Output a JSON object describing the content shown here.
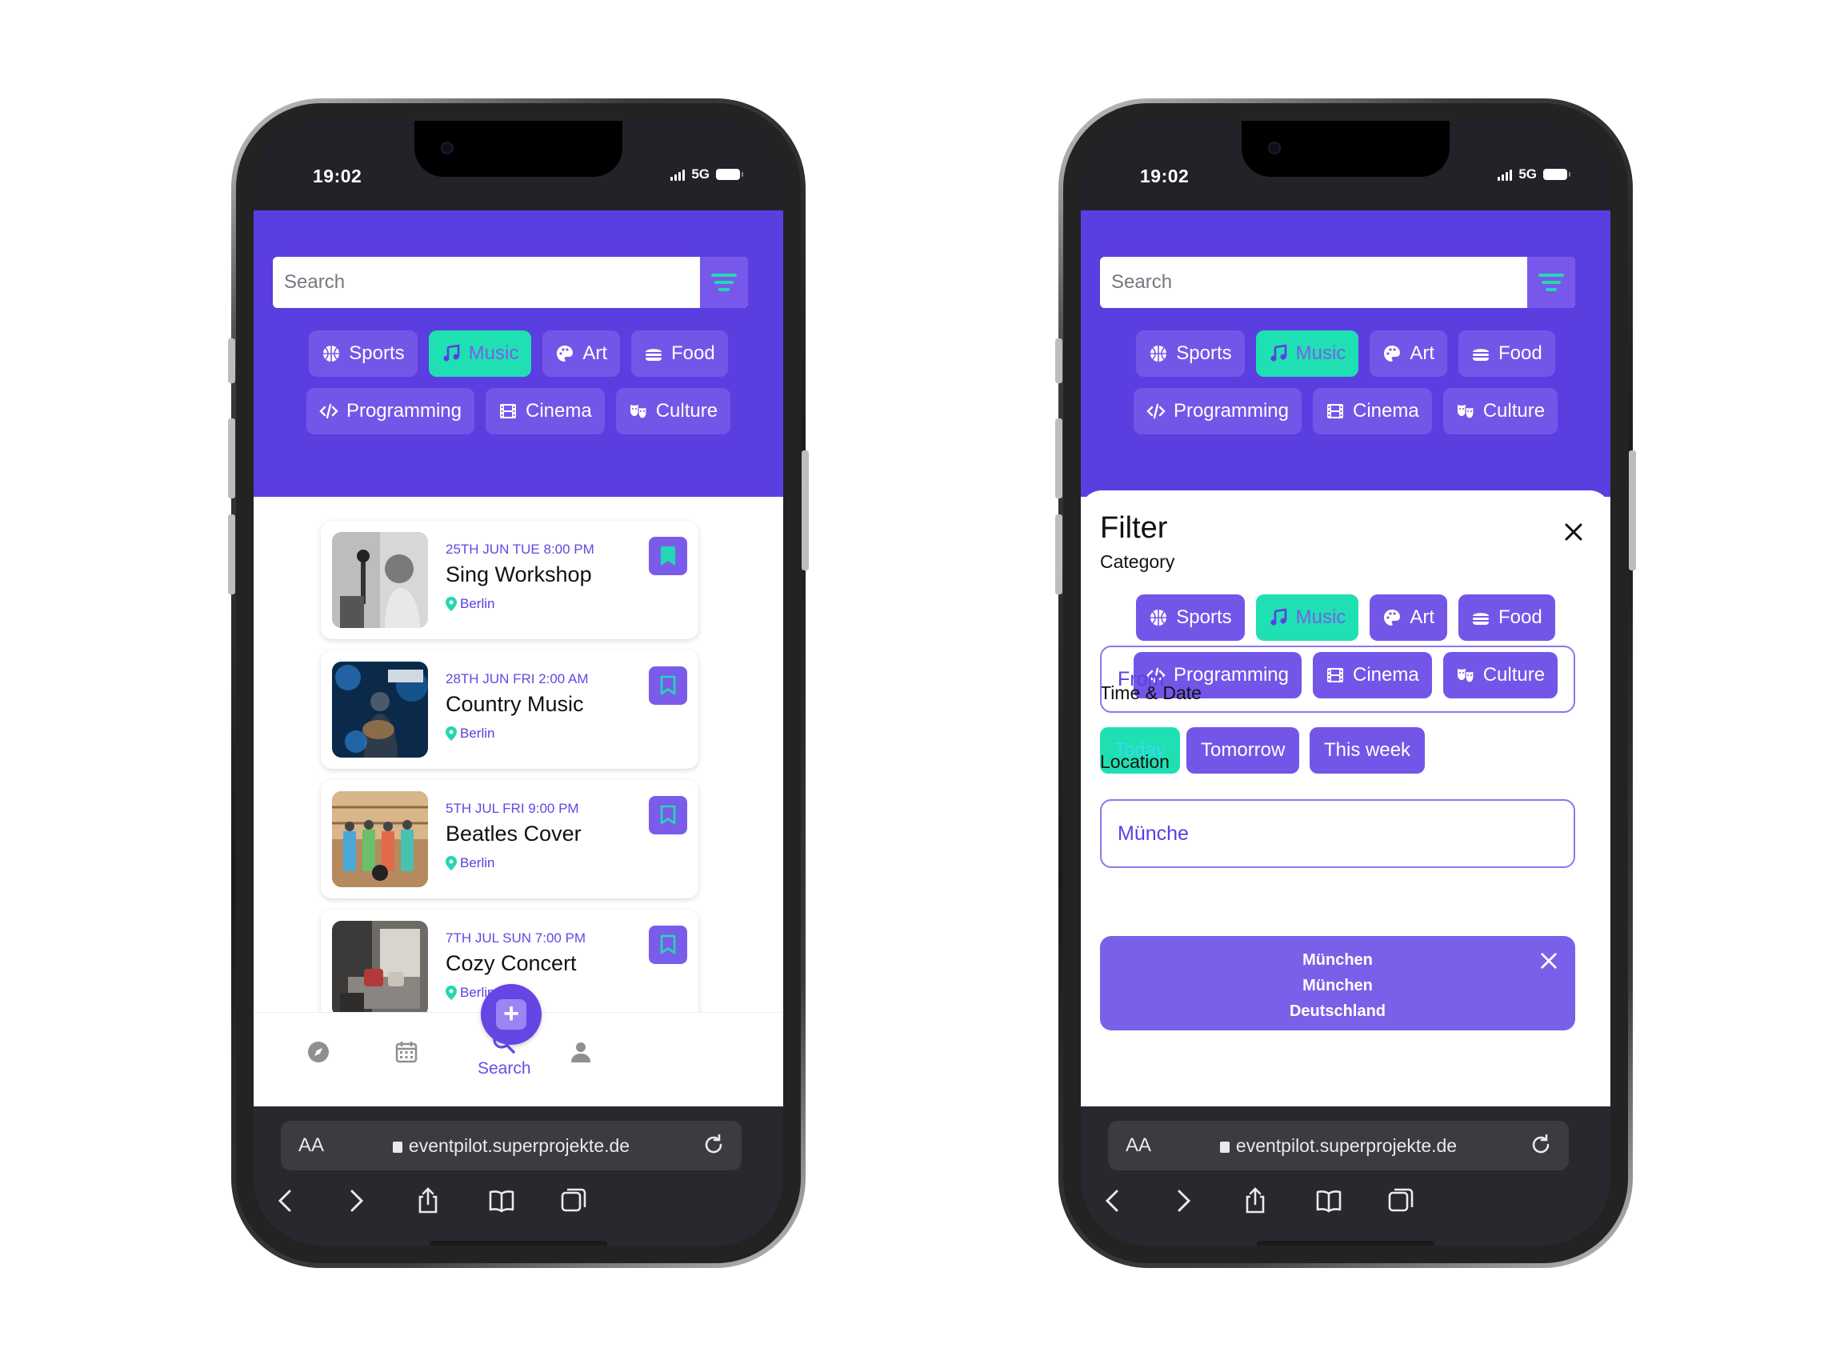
{
  "status": {
    "time": "19:02",
    "network": "5G"
  },
  "search": {
    "placeholder": "Search"
  },
  "categories": [
    {
      "label": "Sports",
      "icon": "basketball-icon",
      "selected": false
    },
    {
      "label": "Music",
      "icon": "music-note-icon",
      "selected": true
    },
    {
      "label": "Art",
      "icon": "palette-icon",
      "selected": false
    },
    {
      "label": "Food",
      "icon": "burger-icon",
      "selected": false
    },
    {
      "label": "Programming",
      "icon": "code-icon",
      "selected": false
    },
    {
      "label": "Cinema",
      "icon": "film-icon",
      "selected": false
    },
    {
      "label": "Culture",
      "icon": "theater-masks-icon",
      "selected": false
    }
  ],
  "events": [
    {
      "date": "25TH JUN TUE 8:00 PM",
      "title": "Sing Workshop",
      "location": "Berlin",
      "bookmarked": true
    },
    {
      "date": "28TH JUN FRI 2:00 AM",
      "title": "Country Music",
      "location": "Berlin",
      "bookmarked": false
    },
    {
      "date": "5TH JUL FRI 9:00 PM",
      "title": "Beatles Cover",
      "location": "Berlin",
      "bookmarked": false
    },
    {
      "date": "7TH JUL SUN 7:00 PM",
      "title": "Cozy Concert",
      "location": "Berlin",
      "bookmarked": false
    }
  ],
  "bottom_nav": {
    "items": [
      {
        "icon": "compass-icon"
      },
      {
        "icon": "calendar-icon"
      },
      {
        "icon": "search-icon",
        "label": "Search",
        "active": true
      },
      {
        "icon": "user-icon"
      }
    ],
    "fab": "+"
  },
  "browser": {
    "aa": "AA",
    "url": "eventpilot.superprojekte.de"
  },
  "filter": {
    "title": "Filter",
    "category_label": "Category",
    "time_label": "Time & Date",
    "time_options": [
      {
        "label": "Today",
        "selected": true
      },
      {
        "label": "Tomorrow",
        "selected": false
      },
      {
        "label": "This week",
        "selected": false
      }
    ],
    "from_label": "From",
    "location_label": "Location",
    "location_value": "Münche",
    "suggestion": {
      "line1": "München",
      "line2": "München",
      "line3": "Deutschland"
    }
  },
  "colors": {
    "primary": "#5b3ee0",
    "chip": "#7356e8",
    "accent": "#1fe0b3"
  }
}
